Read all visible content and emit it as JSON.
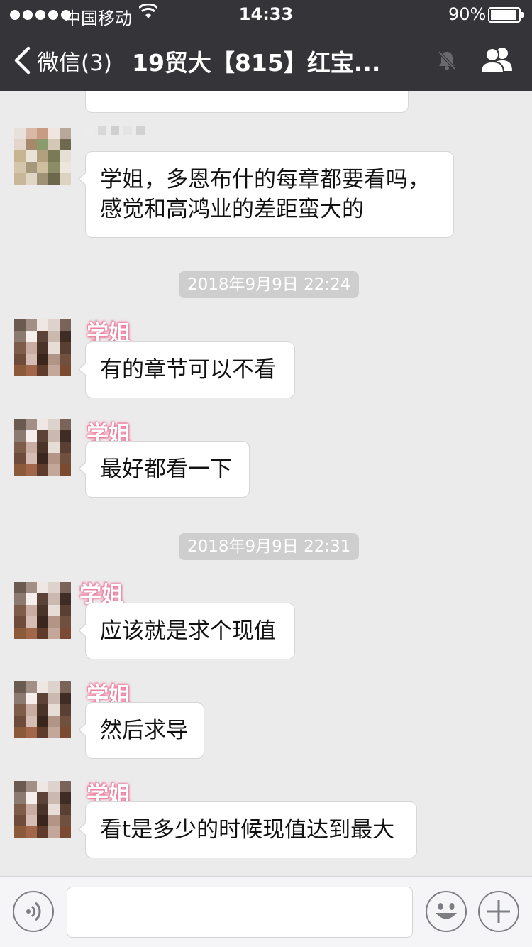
{
  "status_bar": {
    "carrier": "中国移动",
    "time": "14:33",
    "battery": "90%"
  },
  "nav": {
    "back_label": "微信(3)",
    "title": "19贸大【815】红宝..."
  },
  "messages": {
    "m0": {
      "text": ""
    },
    "m1": {
      "text": "学姐，多恩布什的每章都要看吗，感觉和高鸿业的差距蛮大的"
    },
    "ts1": {
      "text": "2018年9月9日 22:24"
    },
    "m2": {
      "sender": "学姐",
      "text": "有的章节可以不看"
    },
    "m3": {
      "sender": "学姐",
      "text": "最好都看一下"
    },
    "ts2": {
      "text": "2018年9月9日 22:31"
    },
    "m4": {
      "sender": "学姐",
      "text": "应该就是求个现值"
    },
    "m5": {
      "sender": "学姐",
      "text": "然后求导"
    },
    "m6": {
      "sender": "学姐",
      "text": "看t是多少的时候现值达到最大"
    }
  },
  "input": {
    "value": ""
  },
  "colors": {
    "nav_bg": "#353539",
    "chat_bg": "#ebebeb",
    "sender_glow": "#f07fa0",
    "timestamp_bg": "#cecece"
  },
  "icons": {
    "back": "chevron-left-icon",
    "mute": "bell-muted-icon",
    "group": "group-info-icon",
    "voice": "voice-icon",
    "emoji": "emoji-icon",
    "plus": "plus-icon"
  }
}
